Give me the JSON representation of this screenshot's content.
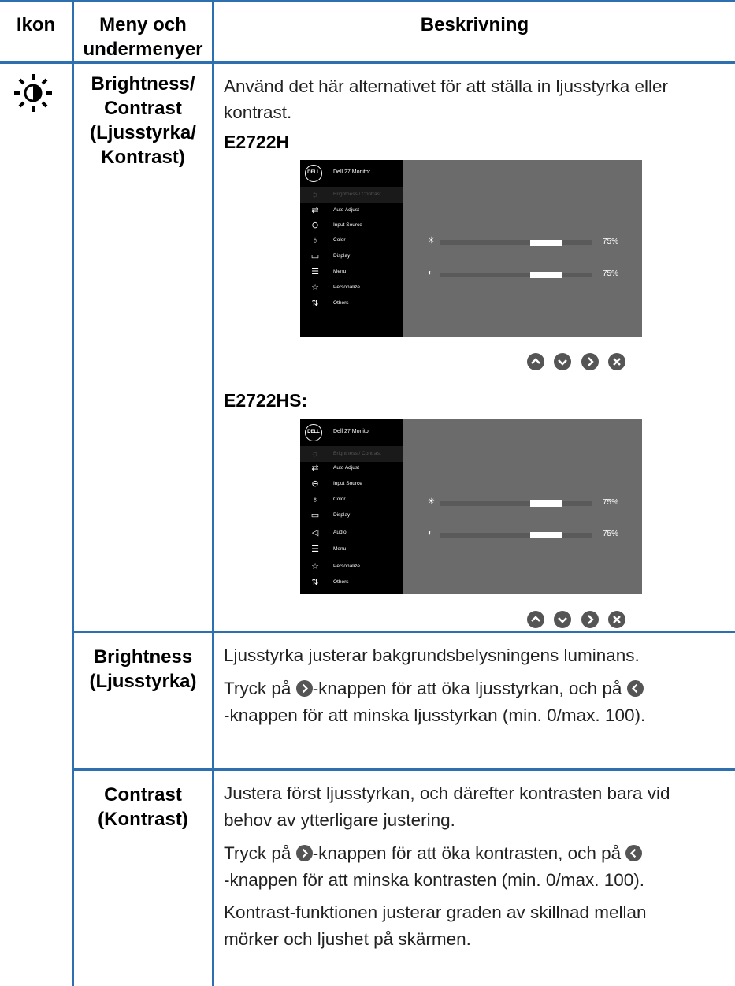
{
  "header": {
    "icon_col": "Ikon",
    "menu_col_line1": "Meny och",
    "menu_col_line2": "undermenyer",
    "desc_col": "Beskrivning"
  },
  "row1": {
    "icon": "brightness-icon",
    "menu_lines": [
      "Brightness/",
      "Contrast",
      "(Ljusstyrka/",
      "Kontrast)"
    ],
    "desc_line1": "Använd det här alternativet för att ställa in ljusstyrka eller",
    "desc_line2": "kontrast.",
    "model1": "E2722H",
    "model2": "E2722HS:"
  },
  "osd1": {
    "title": "Dell 27 Monitor",
    "items": [
      "Brightness / Contrast",
      "Auto Adjust",
      "Input Source",
      "Color",
      "Display",
      "Menu",
      "Personalize",
      "Others"
    ],
    "brightness_pct": "75%",
    "contrast_pct": "75%",
    "brightness_value": 75,
    "contrast_value": 75
  },
  "osd2": {
    "title": "Dell 27 Monitor",
    "items": [
      "Brightness / Contrast",
      "Auto Adjust",
      "Input Source",
      "Color",
      "Display",
      "Audio",
      "Menu",
      "Personalize",
      "Others"
    ],
    "brightness_pct": "75%",
    "contrast_pct": "75%",
    "brightness_value": 75,
    "contrast_value": 75
  },
  "logo_text": "DELL",
  "row2": {
    "menu_line1": "Brightness",
    "menu_line2": "(Ljusstyrka)",
    "p1": "Ljusstyrka justerar bakgrundsbelysningens luminans.",
    "p2a": "Tryck på ",
    "p2b": "-knappen för att öka ljusstyrkan, och på ",
    "p2c": "-knappen för att minska ljusstyrkan (min. 0/max. 100)."
  },
  "row3": {
    "menu_line1": "Contrast",
    "menu_line2": "(Kontrast)",
    "p1a": "Justera först ljusstyrkan, och därefter kontrasten bara vid",
    "p1b": "behov av ytterligare justering.",
    "p2a": "Tryck på ",
    "p2b": "-knappen för att öka kontrasten, och på ",
    "p2c": "-knappen för att minska kontrasten (min. 0/max. 100).",
    "p3a": "Kontrast-funktionen justerar graden av skillnad mellan",
    "p3b": "mörker och ljushet på skärmen."
  },
  "colors": {
    "rule": "#2e6fb0",
    "osd_bg": "#6b6b6b",
    "osd_side": "#000000",
    "button": "#555555"
  }
}
